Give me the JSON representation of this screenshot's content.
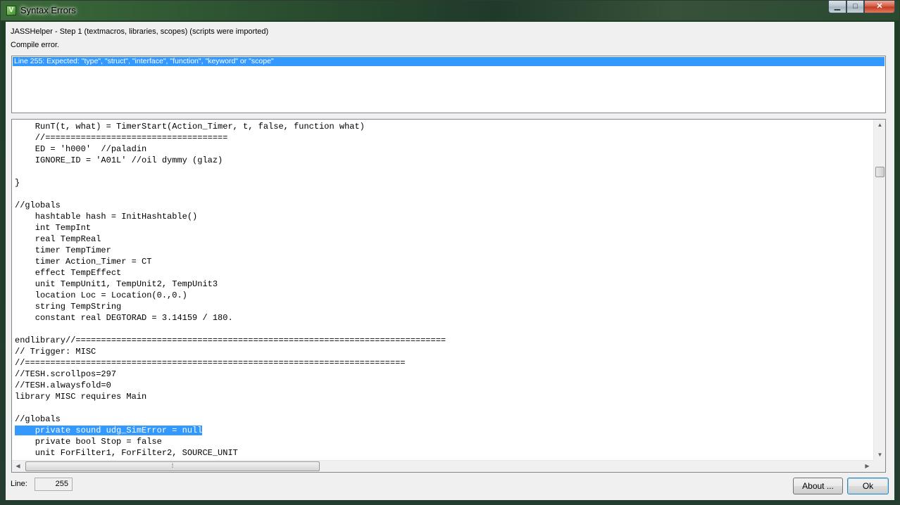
{
  "window": {
    "title": "Syntax Errors",
    "minimize_glyph": "▁",
    "maximize_glyph": "□",
    "close_glyph": "✕"
  },
  "info": {
    "step": "JASSHelper - Step 1 (textmacros, libraries, scopes) (scripts were imported)",
    "status": "Compile error."
  },
  "errors": [
    "Line 255: Expected: \"type\", \"struct\", \"interface\", \"function\", \"keyword\" or \"scope\""
  ],
  "code_lines": [
    "    RunT(t, what) = TimerStart(Action_Timer, t, false, function what)",
    "    //====================================",
    "    ED = 'h000'  //paladin",
    "    IGNORE_ID = 'A01L' //oil dymmy (glaz)",
    "",
    "}",
    "",
    "//globals",
    "    hashtable hash = InitHashtable()",
    "    int TempInt",
    "    real TempReal",
    "    timer TempTimer",
    "    timer Action_Timer = CT",
    "    effect TempEffect",
    "    unit TempUnit1, TempUnit2, TempUnit3",
    "    location Loc = Location(0.,0.)",
    "    string TempString",
    "    constant real DEGTORAD = 3.14159 / 180.",
    "",
    "endlibrary//=========================================================================",
    "// Trigger: MISC",
    "//===========================================================================",
    "//TESH.scrollpos=297",
    "//TESH.alwaysfold=0",
    "library MISC requires Main",
    "",
    "//globals",
    "    private sound udg_SimError = null",
    "    private bool Stop = false",
    "    unit ForFilter1, ForFilter2, SOURCE_UNIT"
  ],
  "highlighted_line_index": 27,
  "footer": {
    "line_label": "Line:",
    "line_value": "255",
    "about_label": "About ...",
    "ok_label": "Ok"
  },
  "colors": {
    "selection": "#3399ff"
  }
}
